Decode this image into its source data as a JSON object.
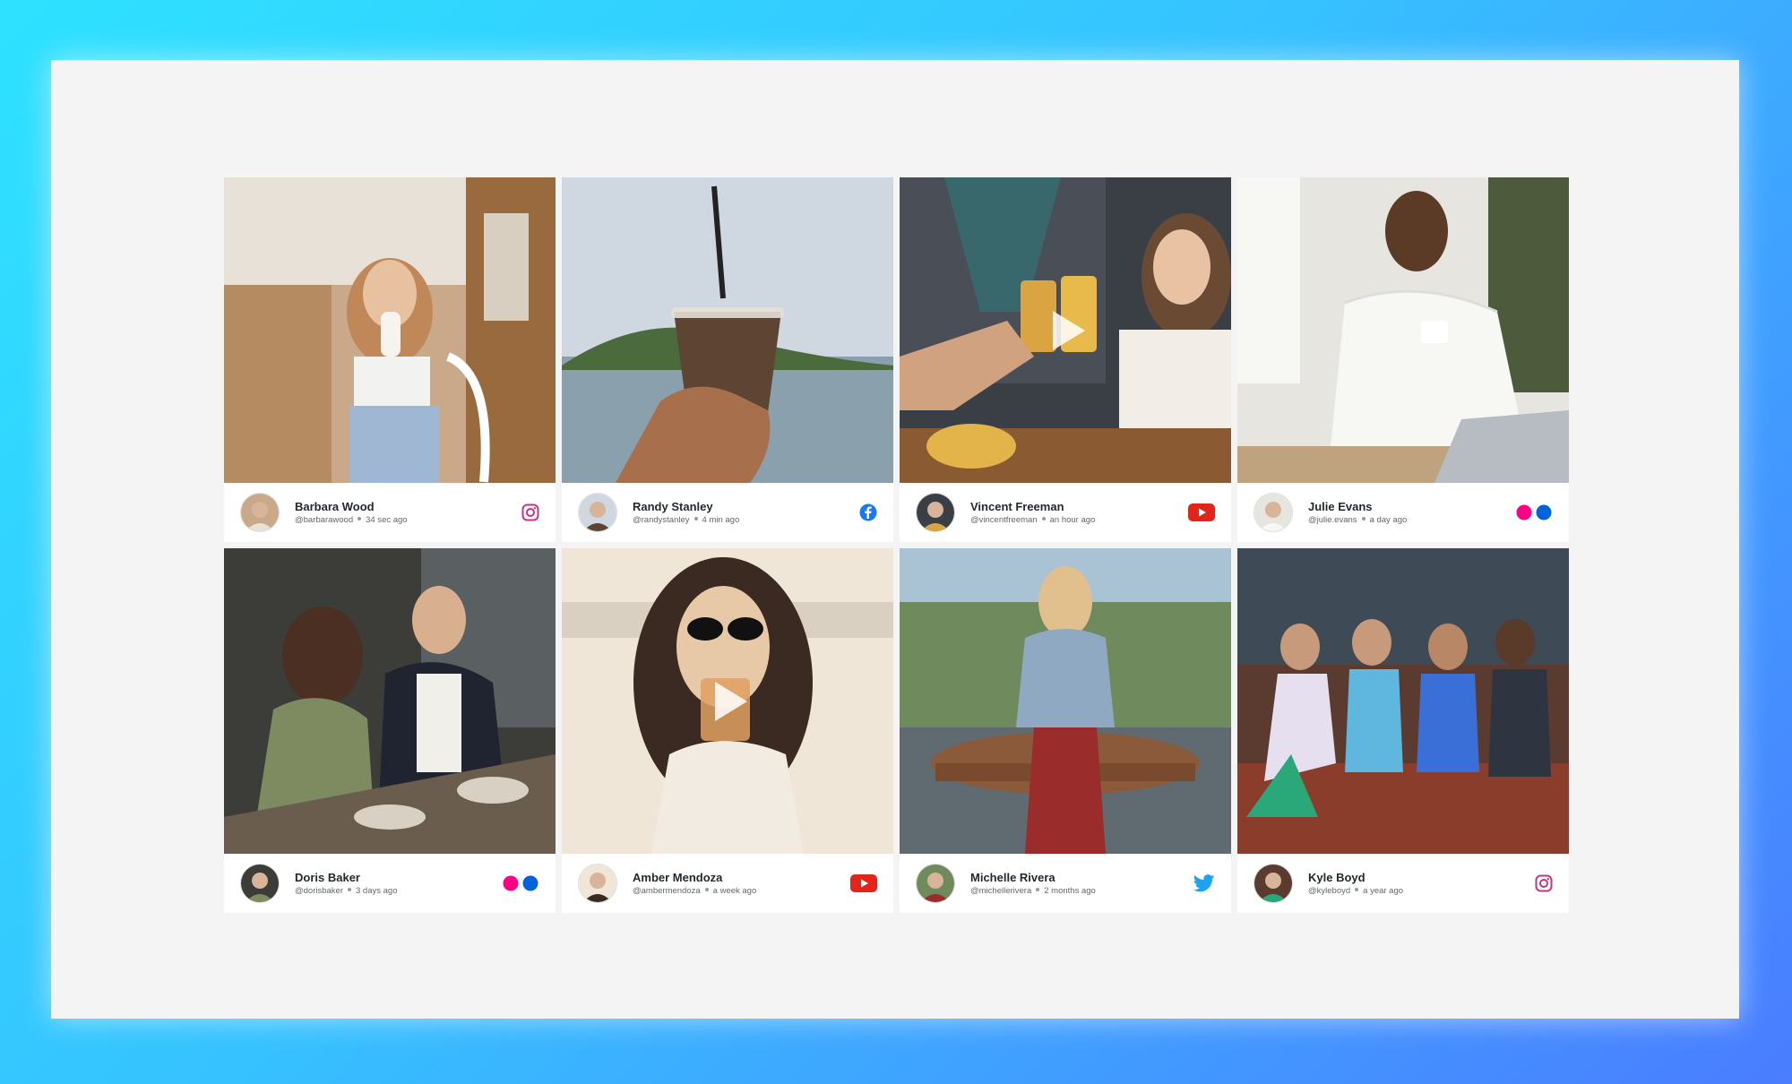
{
  "cards": [
    {
      "name": "Barbara Wood",
      "handle": "@barbarawood",
      "time": "34 sec ago",
      "network": "instagram-icon",
      "video": false,
      "photo": "woman-drinking-milkshake-cafe",
      "colors": [
        "#c9a98a",
        "#e8e1d8",
        "#9fb7d3"
      ]
    },
    {
      "name": "Randy Stanley",
      "handle": "@randystanley",
      "time": "4 min ago",
      "network": "facebook-icon",
      "video": false,
      "photo": "iced-coffee-beach",
      "colors": [
        "#cfd8e0",
        "#5d4433",
        "#8aa1ad"
      ]
    },
    {
      "name": "Vincent Freeman",
      "handle": "@vincentfreeman",
      "time": "an hour ago",
      "network": "youtube-icon",
      "video": true,
      "photo": "friends-toasting-beer",
      "colors": [
        "#3a3f46",
        "#d9a441",
        "#f2ede7"
      ]
    },
    {
      "name": "Julie Evans",
      "handle": "@julie.evans",
      "time": "a day ago",
      "network": "flickr-icon",
      "video": false,
      "photo": "woman-drinking-coffee-laptop",
      "colors": [
        "#e7e5e0",
        "#f7f7f4",
        "#5b3b26"
      ]
    },
    {
      "name": "Doris Baker",
      "handle": "@dorisbaker",
      "time": "3 days ago",
      "network": "flickr-icon",
      "video": false,
      "photo": "couple-cafe-terrace",
      "colors": [
        "#3c3c38",
        "#7e8a5f",
        "#d8d1c3"
      ]
    },
    {
      "name": "Amber Mendoza",
      "handle": "@ambermendoza",
      "time": "a  week ago",
      "network": "youtube-icon",
      "video": true,
      "photo": "woman-sunglasses-drink",
      "colors": [
        "#efe6d8",
        "#3a2a22",
        "#e7c9a8"
      ]
    },
    {
      "name": "Michelle Rivera",
      "handle": "@michellerivera",
      "time": "2 months ago",
      "network": "twitter-icon",
      "video": false,
      "photo": "woman-wine-outdoor",
      "colors": [
        "#6f8a5c",
        "#9b2c2c",
        "#a9c2d4"
      ]
    },
    {
      "name": "Kyle Boyd",
      "handle": "@kyleboyd",
      "time": "a year ago",
      "network": "instagram-icon",
      "video": false,
      "photo": "friends-sitting-storefront",
      "colors": [
        "#5b3a30",
        "#2aa87a",
        "#3a6fd8"
      ]
    }
  ],
  "brand_colors": {
    "instagram": "#c13584",
    "facebook": "#1877f2",
    "youtube": "#e0261b",
    "twitter": "#1da1f2",
    "flickr_pink": "#ff0084",
    "flickr_blue": "#0063dc"
  }
}
